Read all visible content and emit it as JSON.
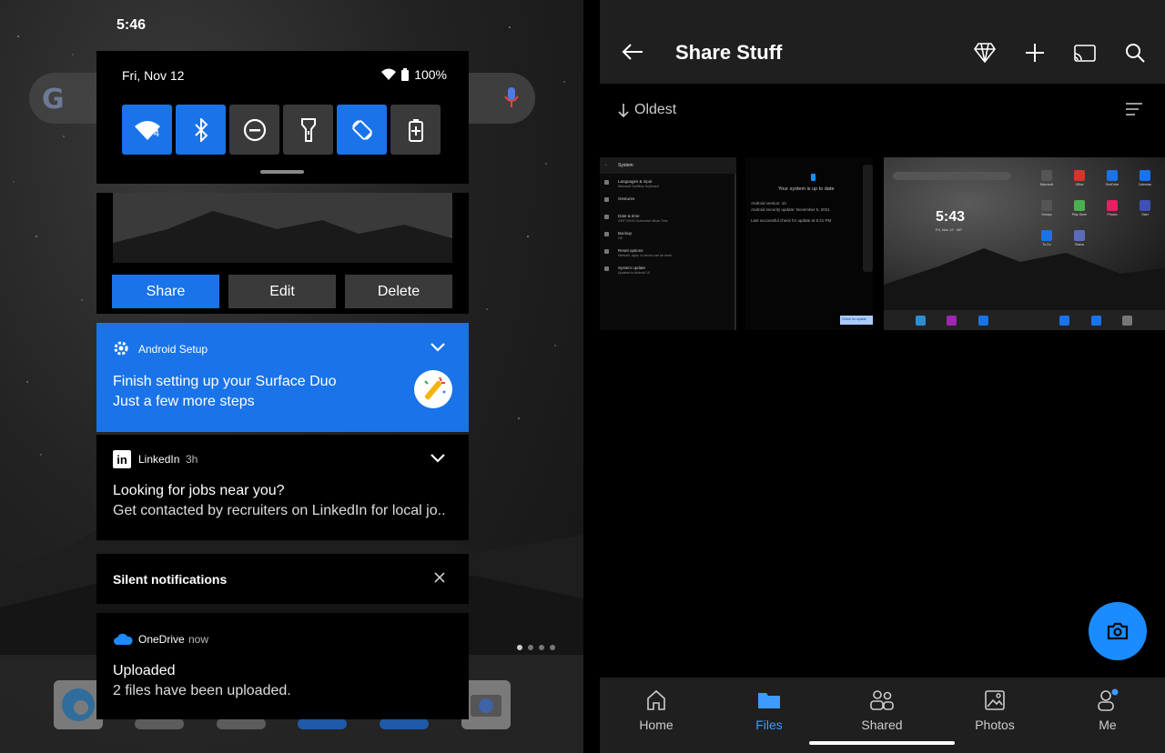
{
  "left": {
    "status_time": "5:46",
    "quick_settings": {
      "date": "Fri, Nov 12",
      "battery": "100%",
      "tiles": [
        {
          "name": "wifi",
          "on": true
        },
        {
          "name": "bluetooth",
          "on": true
        },
        {
          "name": "do-not-disturb",
          "on": false
        },
        {
          "name": "flashlight",
          "on": false
        },
        {
          "name": "auto-rotate",
          "on": true
        },
        {
          "name": "battery-saver",
          "on": false
        }
      ],
      "wifi_badge": "4"
    },
    "photo_notification": {
      "share_label": "Share",
      "edit_label": "Edit",
      "delete_label": "Delete"
    },
    "setup_notification": {
      "app": "Android Setup",
      "title": "Finish setting up your Surface Duo",
      "subtitle": "Just a few more steps"
    },
    "linkedin_notification": {
      "app": "LinkedIn",
      "time": "3h",
      "logo": "in",
      "title": "Looking for jobs near you?",
      "subtitle": "Get contacted by recruiters on LinkedIn for local jo.."
    },
    "silent": {
      "label": "Silent notifications"
    },
    "onedrive_notification": {
      "app": "OneDrive",
      "time": "now",
      "title": "Uploaded",
      "subtitle": "2 files have been uploaded."
    }
  },
  "right": {
    "title": "Share Stuff",
    "sort_label": "Oldest",
    "thumbnails": {
      "settings": {
        "header": "System",
        "items": [
          [
            "Languages & input",
            "Microsoft SwiftKey Keyboard"
          ],
          [
            "Gestures",
            ""
          ],
          [
            "Date & time",
            "GMT+00:00 Greenwich Mean Time"
          ],
          [
            "Backup",
            "Off"
          ],
          [
            "Reset options",
            "Network, apps, or device can be reset"
          ],
          [
            "System update",
            "Updated to Android 10"
          ]
        ]
      },
      "update": {
        "title": "Your system is up to date",
        "line1": "Android version: 10",
        "line2": "Android security update: November 5, 2021",
        "line3": "Last successful check for update at 5:41 PM",
        "button": "Check for update"
      },
      "home": {
        "time": "5:43",
        "date": "Fri, Nov 12 · 58°",
        "apps": [
          "Microsoft",
          "Office",
          "OneDrive",
          "Calendar",
          "Groups",
          "Play Store",
          "Photos",
          "Start",
          "To Do",
          "Teams"
        ]
      }
    },
    "nav": [
      {
        "label": "Home",
        "active": false
      },
      {
        "label": "Files",
        "active": true
      },
      {
        "label": "Shared",
        "active": false
      },
      {
        "label": "Photos",
        "active": false
      },
      {
        "label": "Me",
        "active": false
      }
    ],
    "colors": {
      "accent": "#1a8cff",
      "active_nav": "#3d9bff",
      "toggle_on": "#1a73e8"
    }
  }
}
